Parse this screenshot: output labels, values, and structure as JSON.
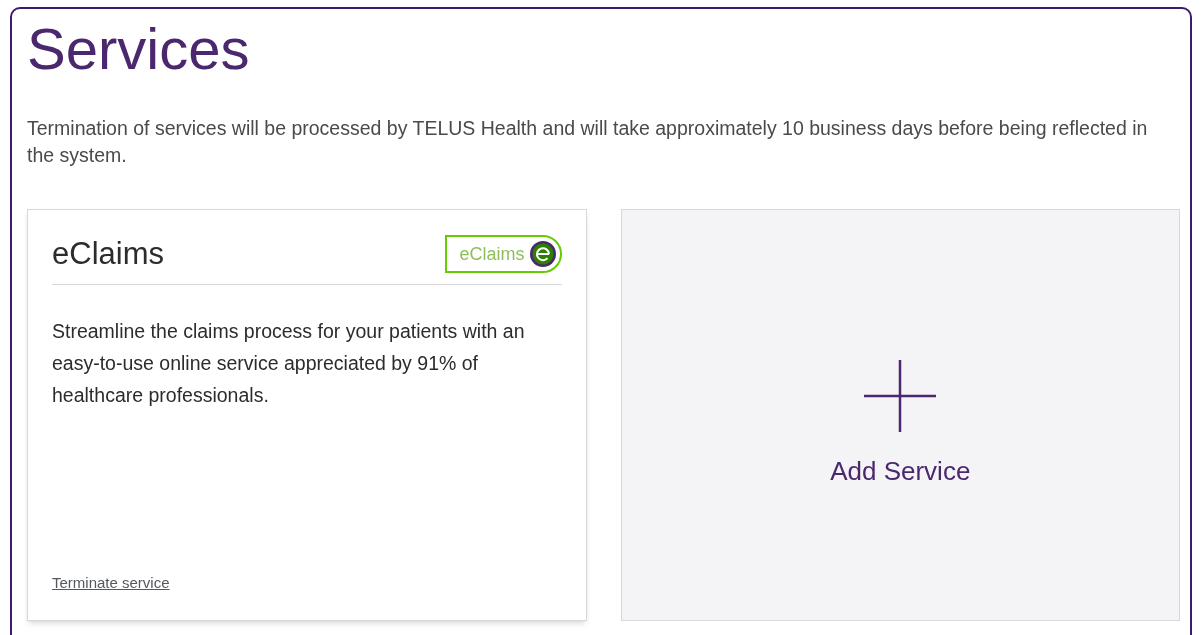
{
  "heading": "Services",
  "notice": "Termination of services will be processed by TELUS Health and will take approximately 10 business days before being reflected in the system.",
  "service_cards": [
    {
      "title": "eClaims",
      "logo_text": "eClaims",
      "description": "Streamline the claims process for your patients with an easy-to-use online service appreciated by 91% of healthcare professionals.",
      "action_link": "Terminate service"
    }
  ],
  "add_card": {
    "label": "Add Service"
  }
}
